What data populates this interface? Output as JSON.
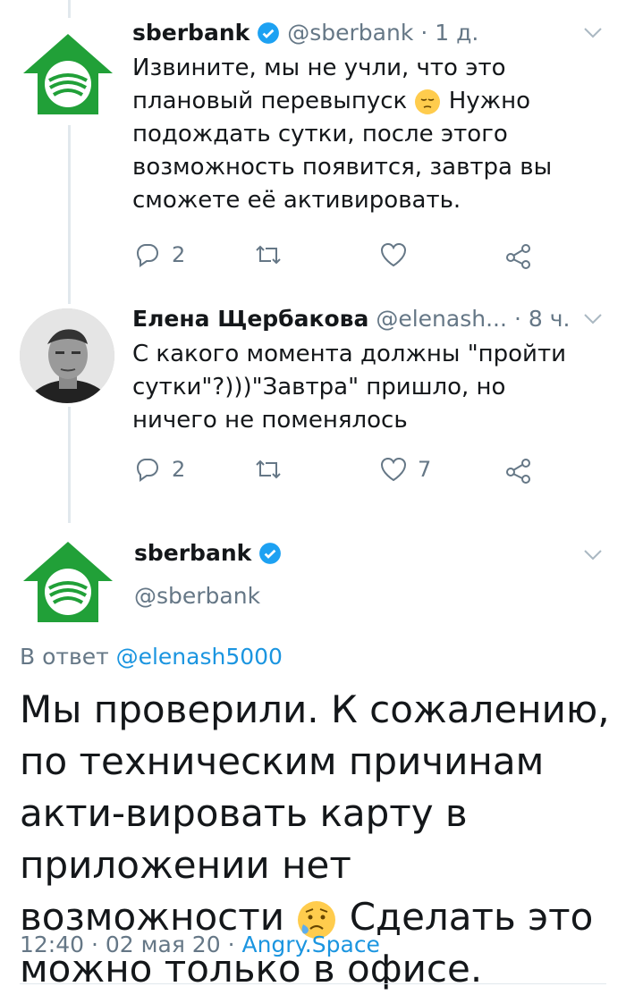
{
  "tweet1": {
    "display_name": "sberbank",
    "handle": "@sberbank",
    "time": "1 д.",
    "text_part1": "Извините, мы не учли, что это плановый перевыпуск ",
    "emoji": "pensive-face",
    "text_part2": " Нужно подождать сутки, после этого возможность появится, завтра вы сможете её активировать.",
    "reply_count": "2",
    "retweet_count": "",
    "like_count": ""
  },
  "tweet2": {
    "display_name": "Елена Щербакова",
    "handle": "@elenash...",
    "time": "8 ч.",
    "text": "С какого момента должны \"пройти сутки\"?)))\"Завтра\" пришло, но ничего не поменялось",
    "reply_count": "2",
    "retweet_count": "",
    "like_count": "7"
  },
  "main_tweet": {
    "display_name": "sberbank",
    "handle": "@sberbank",
    "reply_prefix": "В ответ",
    "reply_mention": "@elenash5000",
    "text_part1": "Мы проверили. К сожалению, по техническим причинам акти-вировать карту в приложении нет возможности ",
    "emoji": "sad-but-relieved-face",
    "text_part2": " Сделать это можно только в офисе.",
    "timestamp": "12:40 · 02 мая 20",
    "separator": "·",
    "source": "Angry.Space"
  },
  "colors": {
    "brand_green": "#21a038",
    "link_blue": "#1b95e0",
    "secondary_text": "#657786",
    "verified_blue": "#1da1f2"
  },
  "icons": [
    "reply-icon",
    "retweet-icon",
    "like-icon",
    "share-icon",
    "verified-icon",
    "chevron-down-icon",
    "sberbank-logo"
  ]
}
